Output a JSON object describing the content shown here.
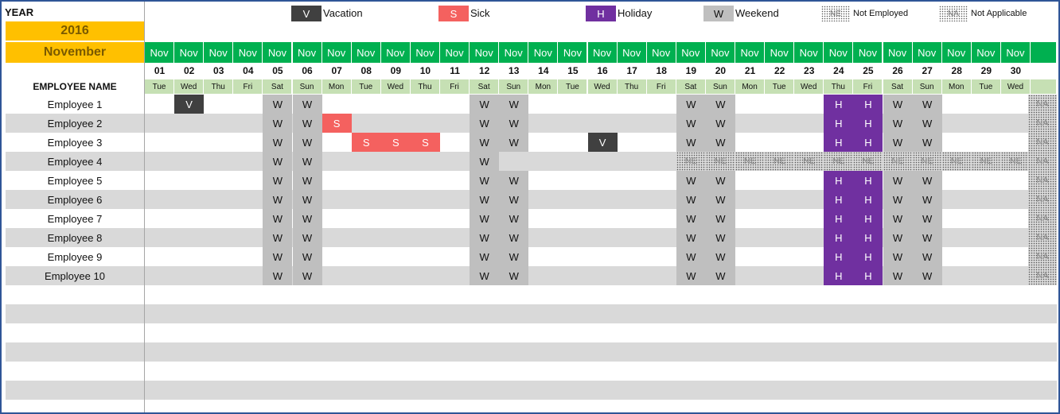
{
  "header": {
    "year_label": "YEAR",
    "year_value": "2016",
    "month_value": "November",
    "employee_header": "EMPLOYEE NAME"
  },
  "legend": [
    {
      "code": "V",
      "label": "Vacation",
      "color": "#404040"
    },
    {
      "code": "S",
      "label": "Sick",
      "color": "#f4615f"
    },
    {
      "code": "H",
      "label": "Holiday",
      "color": "#7030a0"
    },
    {
      "code": "W",
      "label": "Weekend",
      "color": "#bfbfbf"
    },
    {
      "code": "NE",
      "label": "Not Employed",
      "color": "dotted"
    },
    {
      "code": "NA",
      "label": "Not Applicable",
      "color": "dotted"
    }
  ],
  "colors": {
    "month_header": "#00b050",
    "dow_header": "#c6e0b4",
    "year_bg": "#ffc000",
    "row_alt": "#d9d9d9",
    "frame": "#2f5597"
  },
  "days": [
    {
      "mon": "Nov",
      "num": "01",
      "dow": "Tue"
    },
    {
      "mon": "Nov",
      "num": "02",
      "dow": "Wed"
    },
    {
      "mon": "Nov",
      "num": "03",
      "dow": "Thu"
    },
    {
      "mon": "Nov",
      "num": "04",
      "dow": "Fri"
    },
    {
      "mon": "Nov",
      "num": "05",
      "dow": "Sat"
    },
    {
      "mon": "Nov",
      "num": "06",
      "dow": "Sun"
    },
    {
      "mon": "Nov",
      "num": "07",
      "dow": "Mon"
    },
    {
      "mon": "Nov",
      "num": "08",
      "dow": "Tue"
    },
    {
      "mon": "Nov",
      "num": "09",
      "dow": "Wed"
    },
    {
      "mon": "Nov",
      "num": "10",
      "dow": "Thu"
    },
    {
      "mon": "Nov",
      "num": "11",
      "dow": "Fri"
    },
    {
      "mon": "Nov",
      "num": "12",
      "dow": "Sat"
    },
    {
      "mon": "Nov",
      "num": "13",
      "dow": "Sun"
    },
    {
      "mon": "Nov",
      "num": "14",
      "dow": "Mon"
    },
    {
      "mon": "Nov",
      "num": "15",
      "dow": "Tue"
    },
    {
      "mon": "Nov",
      "num": "16",
      "dow": "Wed"
    },
    {
      "mon": "Nov",
      "num": "17",
      "dow": "Thu"
    },
    {
      "mon": "Nov",
      "num": "18",
      "dow": "Fri"
    },
    {
      "mon": "Nov",
      "num": "19",
      "dow": "Sat"
    },
    {
      "mon": "Nov",
      "num": "20",
      "dow": "Sun"
    },
    {
      "mon": "Nov",
      "num": "21",
      "dow": "Mon"
    },
    {
      "mon": "Nov",
      "num": "22",
      "dow": "Tue"
    },
    {
      "mon": "Nov",
      "num": "23",
      "dow": "Wed"
    },
    {
      "mon": "Nov",
      "num": "24",
      "dow": "Thu"
    },
    {
      "mon": "Nov",
      "num": "25",
      "dow": "Fri"
    },
    {
      "mon": "Nov",
      "num": "26",
      "dow": "Sat"
    },
    {
      "mon": "Nov",
      "num": "27",
      "dow": "Sun"
    },
    {
      "mon": "Nov",
      "num": "28",
      "dow": "Mon"
    },
    {
      "mon": "Nov",
      "num": "29",
      "dow": "Tue"
    },
    {
      "mon": "Nov",
      "num": "30",
      "dow": "Wed"
    }
  ],
  "employees": [
    {
      "name": "Employee 1",
      "marks": [
        "",
        "V",
        "",
        "",
        "W",
        "W",
        "",
        "",
        "",
        "",
        "",
        "W",
        "W",
        "",
        "",
        "",
        "",
        "",
        "W",
        "W",
        "",
        "",
        "",
        "H",
        "H",
        "W",
        "W",
        "",
        "",
        ""
      ],
      "tail": "NA"
    },
    {
      "name": "Employee 2",
      "marks": [
        "",
        "",
        "",
        "",
        "W",
        "W",
        "S",
        "",
        "",
        "",
        "",
        "W",
        "W",
        "",
        "",
        "",
        "",
        "",
        "W",
        "W",
        "",
        "",
        "",
        "H",
        "H",
        "W",
        "W",
        "",
        "",
        ""
      ],
      "tail": "NA"
    },
    {
      "name": "Employee 3",
      "marks": [
        "",
        "",
        "",
        "",
        "W",
        "W",
        "",
        "S",
        "S",
        "S",
        "",
        "W",
        "W",
        "",
        "",
        "V",
        "",
        "",
        "W",
        "W",
        "",
        "",
        "",
        "H",
        "H",
        "W",
        "W",
        "",
        "",
        ""
      ],
      "tail": "NA"
    },
    {
      "name": "Employee 4",
      "marks": [
        "",
        "",
        "",
        "",
        "W",
        "W",
        "",
        "",
        "",
        "",
        "",
        "W",
        "",
        "",
        "",
        "",
        "",
        "",
        "NE",
        "NE",
        "NE",
        "NE",
        "NE",
        "NE",
        "NE",
        "NE",
        "NE",
        "NE",
        "NE",
        "NE"
      ],
      "tail": "NA"
    },
    {
      "name": "Employee 5",
      "marks": [
        "",
        "",
        "",
        "",
        "W",
        "W",
        "",
        "",
        "",
        "",
        "",
        "W",
        "W",
        "",
        "",
        "",
        "",
        "",
        "W",
        "W",
        "",
        "",
        "",
        "H",
        "H",
        "W",
        "W",
        "",
        "",
        ""
      ],
      "tail": "NA"
    },
    {
      "name": "Employee 6",
      "marks": [
        "",
        "",
        "",
        "",
        "W",
        "W",
        "",
        "",
        "",
        "",
        "",
        "W",
        "W",
        "",
        "",
        "",
        "",
        "",
        "W",
        "W",
        "",
        "",
        "",
        "H",
        "H",
        "W",
        "W",
        "",
        "",
        ""
      ],
      "tail": "NA"
    },
    {
      "name": "Employee 7",
      "marks": [
        "",
        "",
        "",
        "",
        "W",
        "W",
        "",
        "",
        "",
        "",
        "",
        "W",
        "W",
        "",
        "",
        "",
        "",
        "",
        "W",
        "W",
        "",
        "",
        "",
        "H",
        "H",
        "W",
        "W",
        "",
        "",
        ""
      ],
      "tail": "NA"
    },
    {
      "name": "Employee 8",
      "marks": [
        "",
        "",
        "",
        "",
        "W",
        "W",
        "",
        "",
        "",
        "",
        "",
        "W",
        "W",
        "",
        "",
        "",
        "",
        "",
        "W",
        "W",
        "",
        "",
        "",
        "H",
        "H",
        "W",
        "W",
        "",
        "",
        ""
      ],
      "tail": "NA"
    },
    {
      "name": "Employee 9",
      "marks": [
        "",
        "",
        "",
        "",
        "W",
        "W",
        "",
        "",
        "",
        "",
        "",
        "W",
        "W",
        "",
        "",
        "",
        "",
        "",
        "W",
        "W",
        "",
        "",
        "",
        "H",
        "H",
        "W",
        "W",
        "",
        "",
        ""
      ],
      "tail": "NA"
    },
    {
      "name": "Employee 10",
      "marks": [
        "",
        "",
        "",
        "",
        "W",
        "W",
        "",
        "",
        "",
        "",
        "",
        "W",
        "W",
        "",
        "",
        "",
        "",
        "",
        "W",
        "W",
        "",
        "",
        "",
        "H",
        "H",
        "W",
        "W",
        "",
        "",
        ""
      ],
      "tail": "NA"
    }
  ]
}
